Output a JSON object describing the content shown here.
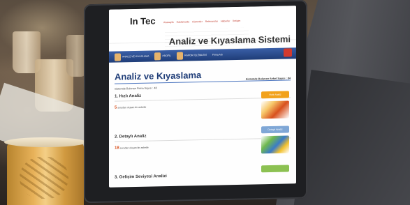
{
  "screen": {
    "logo": "In Tec",
    "logo_subtitle": "",
    "nav": [
      "Anasayfa",
      "Hakkımızda",
      "Hizmetler",
      "Referanslar",
      "Haberler",
      "İletişim"
    ],
    "title": "Analiz ve Kıyaslama Sistemi",
    "bar": {
      "items": [
        "ANALİZ VE KIYASLAMA",
        "PROFİL",
        "RAPOR İŞLEMLERİ"
      ],
      "mid": "Firma Adı"
    },
    "page_heading": "Analiz ve Kıyaslama",
    "left_meta": "Sistemde Bulunan Firma Sayısı : 48",
    "right_meta": "Sistemde Bulunan Anket Sayısı : 84",
    "sections": [
      {
        "title": "1. Hızlı Analiz",
        "count": "5",
        "text": "sorudan oluşan bir anketle",
        "button": "Hızlı Analiz",
        "button_color": "#f2a21b"
      },
      {
        "title": "2. Detaylı Analiz",
        "count": "18",
        "text": "sorudan oluşan bir anketle",
        "button": "Detaylı Analiz",
        "button_color": "#7fa7d6"
      },
      {
        "title": "3. Gelişim Seviyesi Analizi",
        "count": "",
        "text": "",
        "button": "",
        "button_color": "#8cc152"
      }
    ]
  }
}
